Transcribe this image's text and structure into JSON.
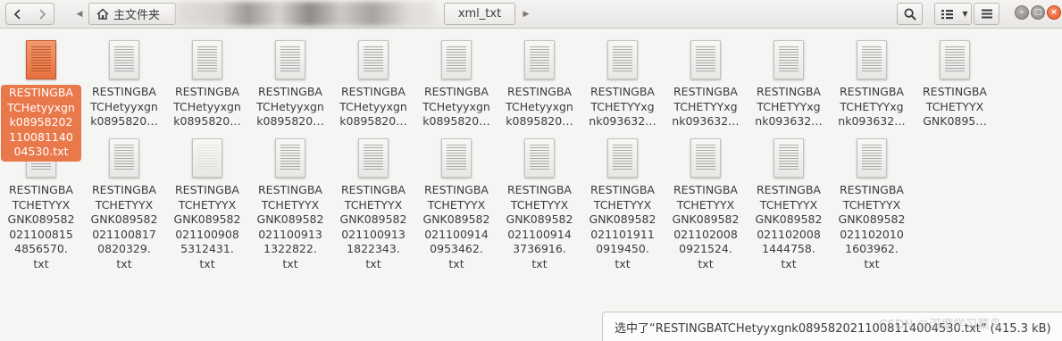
{
  "toolbar": {
    "back_icon": "chevron-left-icon",
    "forward_icon": "chevron-right-icon",
    "home_icon": "home-icon",
    "home_label": "主文件夹",
    "current_folder": "xml_txt",
    "search_icon": "search-icon",
    "view_icon": "grid-view-icon",
    "menu_icon": "hamburger-menu-icon"
  },
  "files": [
    {
      "label": "RESTINGBATCHetyyxgnk0895820211008114004530.txt",
      "display": "RESTINGBA\nTCHetyyxgn\nk08958202\n110081140\n04530.txt",
      "selected": true
    },
    {
      "label": "RESTINGBATCHetyyxgnk0895820…",
      "display": "RESTINGBA\nTCHetyyxgn\nk0895820…"
    },
    {
      "label": "RESTINGBATCHetyyxgnk0895820…",
      "display": "RESTINGBA\nTCHetyyxgn\nk0895820…"
    },
    {
      "label": "RESTINGBATCHetyyxgnk0895820…",
      "display": "RESTINGBA\nTCHetyyxgn\nk0895820…"
    },
    {
      "label": "RESTINGBATCHetyyxgnk0895820…",
      "display": "RESTINGBA\nTCHetyyxgn\nk0895820…"
    },
    {
      "label": "RESTINGBATCHetyyxgnk0895820…",
      "display": "RESTINGBA\nTCHetyyxgn\nk0895820…"
    },
    {
      "label": "RESTINGBATCHetyyxgnk0895820…",
      "display": "RESTINGBA\nTCHetyyxgn\nk0895820…"
    },
    {
      "label": "RESTINGBATCHETYYxgnk093632…",
      "display": "RESTINGBA\nTCHETYYxg\nnk093632…"
    },
    {
      "label": "RESTINGBATCHETYYxgnk093632…",
      "display": "RESTINGBA\nTCHETYYxg\nnk093632…"
    },
    {
      "label": "RESTINGBATCHETYYxgnk093632…",
      "display": "RESTINGBA\nTCHETYYxg\nnk093632…"
    },
    {
      "label": "RESTINGBATCHETYYxgnk093632…",
      "display": "RESTINGBA\nTCHETYYxg\nnk093632…"
    },
    {
      "label": "RESTINGBATCHETYYXGNK0895…",
      "display": "RESTINGBA\nTCHETYYX\nGNK0895…"
    },
    {
      "label": "RESTINGBATCHETYYXGNK0895820211008154856570.txt",
      "display": "RESTINGBA\nTCHETYYX\nGNK089582\n021100815\n4856570.\ntxt"
    },
    {
      "label": "RESTINGBATCHETYYXGNK0895820211008170820329.txt",
      "display": "RESTINGBA\nTCHETYYX\nGNK089582\n021100817\n0820329.\ntxt"
    },
    {
      "label": "RESTINGBATCHETYYXGNK0895820211009085312431.txt",
      "display": "RESTINGBA\nTCHETYYX\nGNK089582\n021100908\n5312431.\ntxt",
      "blank": true
    },
    {
      "label": "RESTINGBATCHETYYXGNK0895820211009131322822.txt",
      "display": "RESTINGBA\nTCHETYYX\nGNK089582\n021100913\n1322822.\ntxt"
    },
    {
      "label": "RESTINGBATCHETYYXGNK0895820211009131822343.txt",
      "display": "RESTINGBA\nTCHETYYX\nGNK089582\n021100913\n1822343.\ntxt"
    },
    {
      "label": "RESTINGBATCHETYYXGNK0895820211009140953462.txt",
      "display": "RESTINGBA\nTCHETYYX\nGNK089582\n021100914\n0953462.\ntxt"
    },
    {
      "label": "RESTINGBATCHETYYXGNK0895820211009143736916.txt",
      "display": "RESTINGBA\nTCHETYYX\nGNK089582\n021100914\n3736916.\ntxt"
    },
    {
      "label": "RESTINGBATCHETYYXGNK0895820211019110919450.txt",
      "display": "RESTINGBA\nTCHETYYX\nGNK089582\n021101911\n0919450.\ntxt"
    },
    {
      "label": "RESTINGBATCHETYYXGNK0895820211020080921524.txt",
      "display": "RESTINGBA\nTCHETYYX\nGNK089582\n021102008\n0921524.\ntxt"
    },
    {
      "label": "RESTINGBATCHETYYXGNK0895820211020081444758.txt",
      "display": "RESTINGBA\nTCHETYYX\nGNK089582\n021102008\n1444758.\ntxt"
    },
    {
      "label": "RESTINGBATCHETYYXGNK0895820211020101603962.txt",
      "display": "RESTINGBA\nTCHETYYX\nGNK089582\n021102010\n1603962.\ntxt"
    }
  ],
  "status": {
    "text": "选中了“RESTINGBATCHetyyxgnk0895820211008114004530.txt” (415.3 kB)"
  },
  "watermark": "CSDN @深度学习菜鸟",
  "colors": {
    "selection": "#e9784a",
    "background": "#f5f5f4"
  }
}
